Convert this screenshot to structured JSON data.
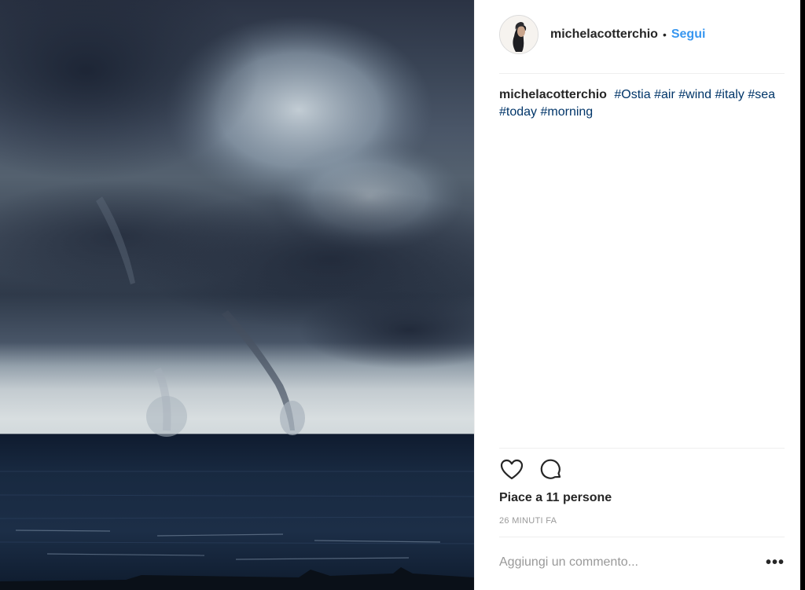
{
  "header": {
    "username": "michelacotterchio",
    "separator": "•",
    "follow_label": "Segui"
  },
  "caption": {
    "username": "michelacotterchio",
    "hashtags": [
      "#Ostia",
      "#air",
      "#wind",
      "#italy",
      "#sea",
      "#today",
      "#morning"
    ]
  },
  "actions": {
    "like_icon": "heart-icon",
    "comment_icon": "comment-icon"
  },
  "likes_text": "Piace a 11 persone",
  "timestamp": "26 minuti fa",
  "comment": {
    "placeholder": "Aggiungi un commento...",
    "more_label": "•••"
  },
  "colors": {
    "follow": "#3897f0",
    "hashtag": "#003569",
    "muted": "#999999"
  }
}
